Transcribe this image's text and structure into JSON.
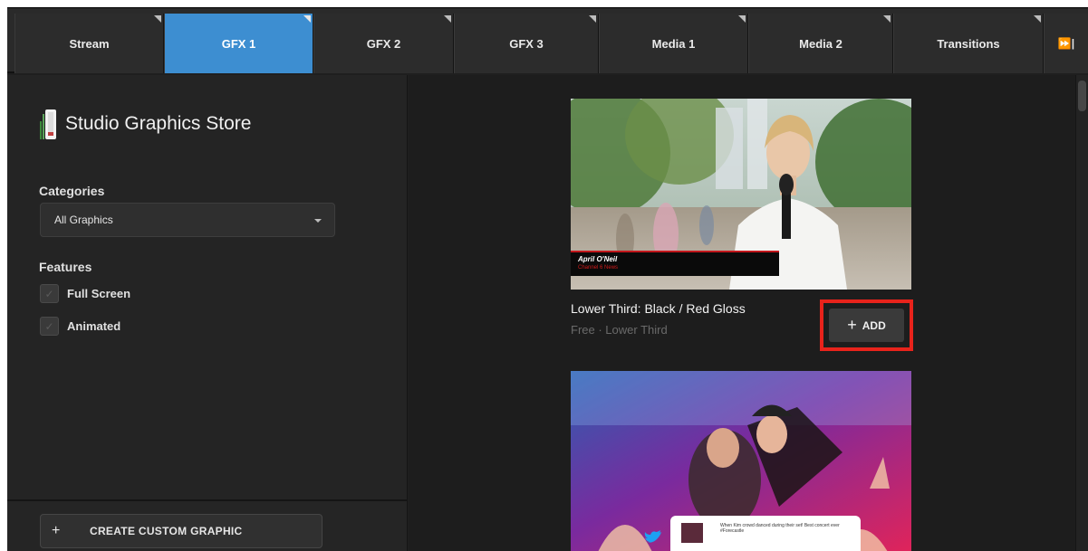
{
  "tabs": [
    {
      "label": "Stream",
      "active": false
    },
    {
      "label": "GFX 1",
      "active": true
    },
    {
      "label": "GFX 2",
      "active": false
    },
    {
      "label": "GFX 3",
      "active": false
    },
    {
      "label": "Media 1",
      "active": false
    },
    {
      "label": "Media 2",
      "active": false
    },
    {
      "label": "Transitions",
      "active": false
    }
  ],
  "tab_more_label": "⏩|",
  "sidebar": {
    "store_title": "Studio Graphics Store",
    "categories_label": "Categories",
    "category_selected": "All Graphics",
    "features_label": "Features",
    "features": [
      {
        "label": "Full Screen",
        "checked": false
      },
      {
        "label": "Animated",
        "checked": false
      }
    ],
    "create_label": "CREATE CUSTOM GRAPHIC",
    "create_icon": "+"
  },
  "cards": [
    {
      "title": "Lower Third: Black / Red Gloss",
      "subtitle": "Free · Lower Third",
      "add_label": "ADD",
      "add_icon": "+",
      "preview_name": "April O'Neil",
      "preview_caption": "Channel 6 News"
    },
    {
      "preview_tweet": "When Kim crowd danced during their set! Best concert ever #Forecastle"
    }
  ],
  "colors": {
    "accent_tab": "#3d8ed1",
    "highlight_red": "#e8231b",
    "background": "#1f1f1f"
  }
}
